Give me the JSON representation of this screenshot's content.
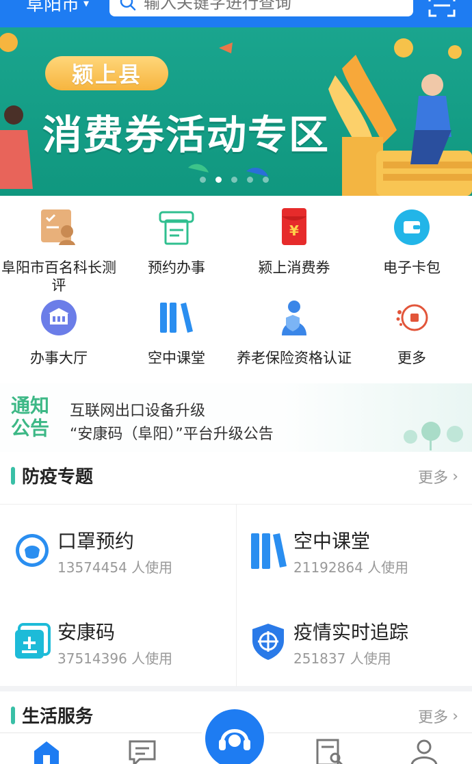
{
  "header": {
    "city": "阜阳市",
    "search_placeholder": "输入关键字进行查询"
  },
  "banner": {
    "badge": "颍上县",
    "title": "消费券活动专区",
    "slides": 5,
    "active_slide": 2
  },
  "services": [
    {
      "label": "阜阳市百名科长测评",
      "icon": "survey-icon"
    },
    {
      "label": "预约办事",
      "icon": "ticket-icon"
    },
    {
      "label": "颍上消费券",
      "icon": "red-envelope-icon"
    },
    {
      "label": "电子卡包",
      "icon": "wallet-icon"
    },
    {
      "label": "办事大厅",
      "icon": "hall-icon"
    },
    {
      "label": "空中课堂",
      "icon": "books-icon"
    },
    {
      "label": "养老保险资格认证",
      "icon": "elder-shield-icon"
    },
    {
      "label": "更多",
      "icon": "more-icon"
    }
  ],
  "notice": {
    "tag": "通知公告",
    "lines": [
      "互联网出口设备升级",
      "“安康码（阜阳）”平台升级公告"
    ]
  },
  "epidemic": {
    "title": "防疫专题",
    "more": "更多",
    "cards": [
      {
        "title": "口罩预约",
        "usage": "13574454 人使用",
        "icon": "mask-icon"
      },
      {
        "title": "空中课堂",
        "usage": "21192864 人使用",
        "icon": "books-icon"
      },
      {
        "title": "安康码",
        "usage": "37514396 人使用",
        "icon": "health-code-icon"
      },
      {
        "title": "疫情实时追踪",
        "usage": "251837 人使用",
        "icon": "tracking-shield-icon"
      }
    ]
  },
  "life": {
    "title": "生活服务",
    "more": "更多"
  },
  "colors": {
    "primary": "#1e7cf2",
    "banner": "#12a087",
    "accent": "#39bfa6",
    "notice_tag": "#3db886"
  },
  "tabbar": [
    "home-icon",
    "message-icon",
    "service-icon",
    "search-doc-icon",
    "user-icon"
  ]
}
